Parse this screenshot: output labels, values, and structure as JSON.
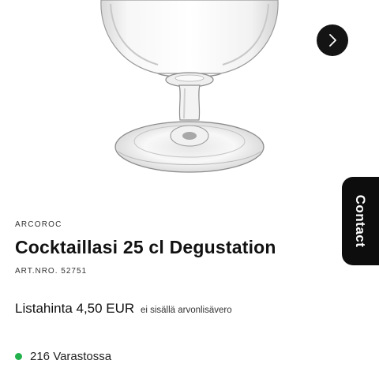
{
  "product": {
    "brand": "ARCOROC",
    "title": "Cocktaillasi 25 cl Degustation",
    "art_nro": "ART.NRO. 52751",
    "price": "Listahinta 4,50 EUR",
    "vat_note": "ei sisällä arvonlisävero",
    "stock": "216 Varastossa"
  },
  "gallery": {
    "next_icon": "chevron-right-icon"
  },
  "contact_tab": {
    "label": "Contact"
  },
  "colors": {
    "dark": "#141414",
    "stock_green": "#22b14c"
  }
}
